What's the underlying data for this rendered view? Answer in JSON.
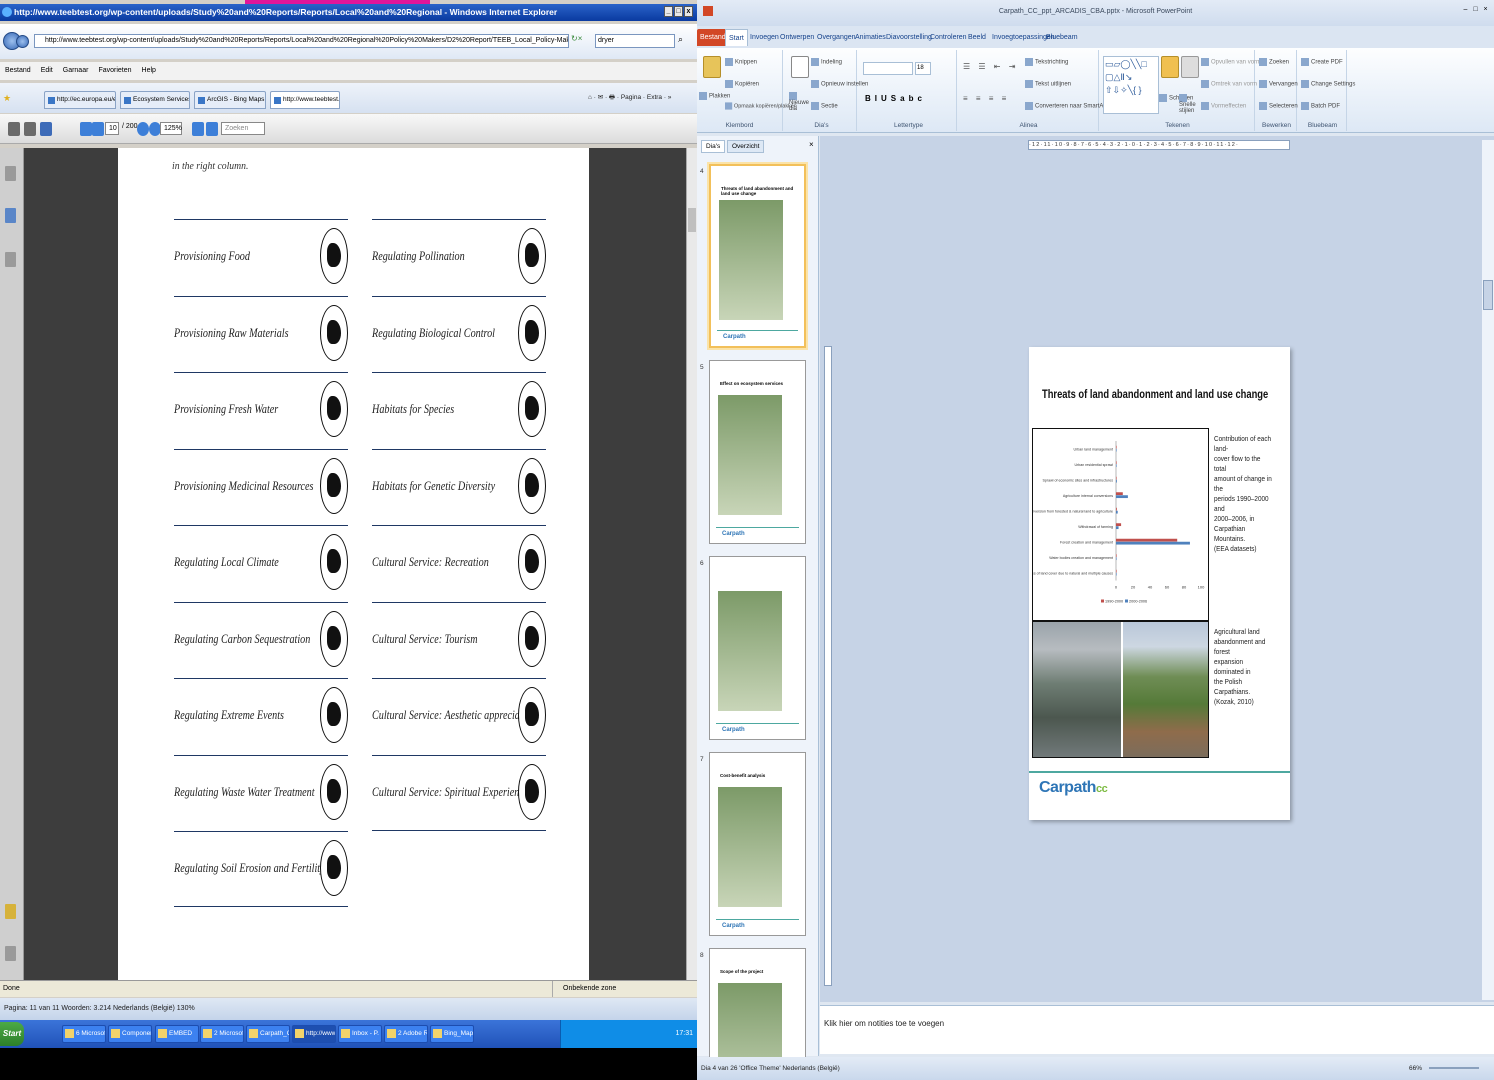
{
  "ie": {
    "title": "http://www.teebtest.org/wp-content/uploads/Study%20and%20Reports/Reports/Local%20and%20Regional - Windows Internet Explorer",
    "url": "http://www.teebtest.org/wp-content/uploads/Study%20and%20Reports/Reports/Local%20and%20Regional%20Policy%20Makers/D2%20Report/TEEB_Local_Policy-Makers_Report.pdf",
    "search_value": "dryer",
    "menu": [
      "Bestand",
      "Edit",
      "Garnaar",
      "Favorieten",
      "Help"
    ],
    "tabs": [
      "http://ec.europa.eu/environ...",
      "Ecosystem Services « TEEB ...",
      "ArcGIS - Bing Maps Aerial, H...",
      "http://www.teebtest.org..."
    ],
    "page_current": "10",
    "page_total": "/ 200",
    "zoom": "125%",
    "find_placeholder": "Zoeken",
    "status": "Done",
    "zone": "Onbekende zone"
  },
  "pdf": {
    "intro": "in the right column.",
    "left_column": [
      "Provisioning Food",
      "Provisioning Raw Materials",
      "Provisioning Fresh Water",
      "Provisioning Medicinal Resources",
      "Regulating Local Climate",
      "Regulating Carbon Sequestration",
      "Regulating Extreme Events",
      "Regulating Waste Water Treatment",
      "Regulating Soil Erosion and Fertility"
    ],
    "right_column": [
      "Regulating Pollination",
      "Regulating Biological Control",
      "Habitats for Species",
      "Habitats for Genetic Diversity",
      "Cultural Service: Recreation",
      "Cultural Service: Tourism",
      "Cultural Service: Aesthetic appreciation",
      "Cultural Service: Spiritual Experience"
    ]
  },
  "word_status": "Pagina: 11 van 11   Woorden: 3.214   Nederlands (België)   130%",
  "taskbar": {
    "start": "Start",
    "items": [
      "6 Microsoft ...",
      "Component n...",
      "EMBED",
      "2 Microsoft ...",
      "Carpath_CC_...",
      "http://www....",
      "Inbox - P. Pet...",
      "2 Adobe Re...",
      "Bing_Maps[1]..."
    ],
    "clock": "17:31"
  },
  "pp": {
    "title": "Carpath_CC_ppt_ARCADIS_CBA.pptx - Microsoft PowerPoint",
    "ribbon_tabs": [
      "Bestand",
      "Start",
      "Invoegen",
      "Ontwerpen",
      "Overgangen",
      "Animaties",
      "Diavoorstelling",
      "Controleren",
      "Beeld",
      "Invoegtoepassingen",
      "Bluebeam"
    ],
    "groups": [
      "Klembord",
      "Dia's",
      "Lettertype",
      "Alinea",
      "Tekenen",
      "Bewerken",
      "Bluebeam"
    ],
    "clipboard": {
      "paste": "Plakken",
      "cut": "Knippen",
      "copy": "Kopiëren",
      "format": "Opmaak kopiëren/plakken"
    },
    "slides_group": {
      "new": "Nieuwe dia",
      "layout": "Indeling",
      "reset": "Opnieuw instellen",
      "section": "Sectie"
    },
    "font_size": "18",
    "paragraph": {
      "dir": "Tekstrichting",
      "align": "Tekst uitlijnen",
      "smartart": "Converteren naar SmartArt"
    },
    "drawing": {
      "arrange": "Schikken",
      "quick": "Snelle stijlen",
      "fill": "Opvullen van vorm",
      "outline": "Omtrek van vorm",
      "effects": "Vormeffecten"
    },
    "editing": {
      "find": "Zoeken",
      "replace": "Vervangen",
      "select": "Selecteren"
    },
    "bluebeam": {
      "create": "Create PDF",
      "change": "Change Settings",
      "batch": "Batch PDF"
    },
    "pane_tabs": [
      "Dia's",
      "Overzicht"
    ],
    "thumbs": [
      {
        "num": "4",
        "title": "Threats of land abandonment and land use change",
        "logo": "Carpath"
      },
      {
        "num": "5",
        "title": "Effect on ecosystem services",
        "logo": "Carpath"
      },
      {
        "num": "6",
        "title": "",
        "logo": "Carpath"
      },
      {
        "num": "7",
        "title": "Cost-benefit analysis",
        "logo": "Carpath"
      },
      {
        "num": "8",
        "title": "Scope of the project",
        "logo": ""
      }
    ],
    "ruler": "·12·11·10·9·8·7·6·5·4·3·2·1·0·1·2·3·4·5·6·7·8·9·10·11·12·",
    "notes_placeholder": "Klik hier om notities toe te voegen",
    "status": "Dia 4 van 26   'Office Theme'   Nederlands (België)",
    "zoom": "66%"
  },
  "slide": {
    "title": "Threats of land abandonment and land use change",
    "chart_caption": "Contribution of each land-\ncover flow to the total\namount of change in the\nperiods 1990–2000 and\n2000–2006, in Carpathian\nMountains.\n(EEA datasets)",
    "photo_caption": "Agricultural land\nabandonment and forest\nexpansion dominated in\nthe Polish Carpathians.\n(Kozak, 2010)",
    "logo": "Carpath",
    "logo_suffix": "cc"
  },
  "chart_data": {
    "type": "bar",
    "orientation": "horizontal",
    "categories": [
      "Urban land management",
      "Urban residential sprawl",
      "Sprawl of economic sites and infrastructures",
      "Agriculture internal conversions",
      "Conversion from forested & natural land to agriculture",
      "Withdrawal of farming",
      "Forest creation and management",
      "Water bodies creation and management",
      "Changes of land cover due to natural and multiple causes"
    ],
    "series": [
      {
        "name": "1990-2000",
        "color": "#c0504d",
        "values": [
          0,
          0,
          0.5,
          8,
          1,
          6,
          72,
          0.5,
          0.5
        ]
      },
      {
        "name": "2000-2006",
        "color": "#4f81bd",
        "values": [
          0,
          0.5,
          1,
          14,
          2,
          3,
          87,
          0.5,
          0.5
        ]
      }
    ],
    "xticks": [
      "0",
      "20",
      "40",
      "60",
      "80",
      "100"
    ],
    "xlim": [
      0,
      100
    ],
    "legend": "bottom"
  }
}
